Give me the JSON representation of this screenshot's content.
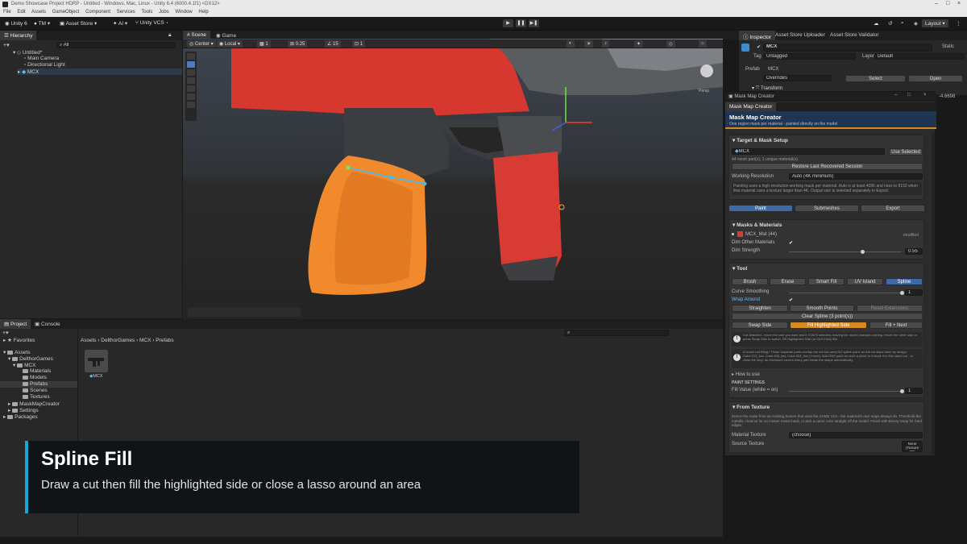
{
  "window": {
    "title": "Demo Showcase Project HDRP - Untitled - Windows, Mac, Linux - Unity 6.4 (6000.4.1f1) <DX12>"
  },
  "menu": [
    "File",
    "Edit",
    "Assets",
    "GameObject",
    "Component",
    "Services",
    "Tools",
    "Jobs",
    "Window",
    "Help"
  ],
  "toolbar": {
    "account": "Unity 6",
    "tm": "TM",
    "asset_store": "Asset Store",
    "ai": "AI",
    "vcs": "Unity VCS",
    "layout": "Layout"
  },
  "hierarchy": {
    "tab": "Hierarchy",
    "search_placeholder": "All",
    "items": [
      {
        "label": "Untitled*"
      },
      {
        "label": "Main Camera"
      },
      {
        "label": "Directional Light"
      },
      {
        "label": "MCX"
      }
    ]
  },
  "scene": {
    "tabs": [
      "Scene",
      "Game"
    ],
    "pivot": "Center",
    "space": "Local",
    "grid_value": "1",
    "snap_value": "0.25",
    "angle_value": "15",
    "scale_value": "1",
    "persp": "Persp"
  },
  "project": {
    "tabs": [
      "Project",
      "Console"
    ],
    "favorites": "Favorites",
    "tree": [
      {
        "label": "Assets",
        "level": 0
      },
      {
        "label": "DelthorGames",
        "level": 1
      },
      {
        "label": "MCX",
        "level": 2
      },
      {
        "label": "Materials",
        "level": 3
      },
      {
        "label": "Models",
        "level": 3
      },
      {
        "label": "Prefabs",
        "level": 3
      },
      {
        "label": "Scenes",
        "level": 3
      },
      {
        "label": "Textures",
        "level": 3
      },
      {
        "label": "MaskMapCreator",
        "level": 1
      },
      {
        "label": "Settings",
        "level": 1
      },
      {
        "label": "Packages",
        "level": 0
      }
    ],
    "breadcrumb": [
      "Assets",
      "DelthorGames",
      "MCX",
      "Prefabs"
    ],
    "asset_label": "MCX"
  },
  "inspector": {
    "tabs": [
      "Inspector",
      "Asset Store Uploader",
      "Asset Store Validator"
    ],
    "name": "MCX",
    "static": "Static",
    "tag_label": "Tag",
    "tag": "Untagged",
    "layer_label": "Layer",
    "layer": "Default",
    "prefab_label": "Prefab",
    "prefab": "MCX",
    "overrides": "Overrides",
    "select": "Select",
    "open": "Open",
    "transform": "Transform",
    "value": "-4.6698"
  },
  "mmc": {
    "window_title": "Mask Map Creator",
    "tab": "Mask Map Creator",
    "header": "Mask Map Creator",
    "subtitle": "One region mask per material · painted directly on the model",
    "target": {
      "title": "Target & Mask Setup",
      "object": "MCX",
      "use_selected": "Use Selected",
      "info": "44 mesh part(s), 1 unique material(s).",
      "restore": "Restore Last Recovered Session",
      "res_label": "Working Resolution",
      "res_value": "Auto (4K minimum)",
      "note": "Painting uses a high-resolution working mask per material. Auto is at least 4096 and rises to 8192 when that material uses a texture larger than 4K. Output size is selected separately in Export."
    },
    "modes": [
      "Paint",
      "Submeshes",
      "Export"
    ],
    "masks": {
      "title": "Masks & Materials",
      "material": "MCX_Mat  (44)",
      "modified": "modified",
      "dim_label": "Dim Other Materials",
      "strength_label": "Dim Strength",
      "strength": "0.55"
    },
    "tool": {
      "title": "Tool",
      "tools": [
        "Brush",
        "Erase",
        "Smart Fill",
        "UV Island",
        "Spline"
      ],
      "smooth_label": "Curve Smoothing",
      "smooth_value": "1",
      "wrap_label": "Wrap Around",
      "straighten": "Straighten",
      "smooth_points": "Smooth Points",
      "reset_ext": "Reset Extensions",
      "clear": "Clear Spline (3 point(s))",
      "swap": "Swap Side",
      "fill_side": "Fill Highlighted Side",
      "fill_next": "Fill + Next",
      "warn1": "Cut detected - hover the side you want and it STAYS selected, leaving the model changes nothing. Hover the other side or press Swap Side to switch. Fill Highlighted Side (or Ctrl+Click) fills.",
      "warn2": "A chunk not filling? Those separate parts overlap the cut but carry NO spline point, so the cut skips them by design: Cube.013_low, Cube.008_low, Cube.004_low (+more). Add ONE point on such a piece to include it in this same cut - or close the loop: an enclosure covers every part inside the shape automatically.",
      "how": "How to use",
      "paint_settings": "PAINT SETTINGS",
      "fill_label": "Fill Value (white = on)",
      "fill_value": "1"
    },
    "from_texture": {
      "title": "From Texture",
      "desc": "Derive the mask from an existing texture that uses the SAME UVs - the material's own maps always do. Threshold the metallic channel for an instant metal mask, or pick a camo color straight off the model. Finish with Binary Snap for hard edges.",
      "mat_tex_label": "Material Texture",
      "mat_tex_value": "(choose)",
      "src_label": "Source Texture",
      "none": "None (Texture 2D)"
    }
  },
  "caption": {
    "title": "Spline Fill",
    "subtitle": "Draw a cut then fill the highlighted side or close a lasso around an area"
  },
  "colors": {
    "accent": "#18a8d8",
    "orange": "#d58a21",
    "blue": "#3d6aa6",
    "red": "#d83a34",
    "grip": "#f08a2c"
  }
}
